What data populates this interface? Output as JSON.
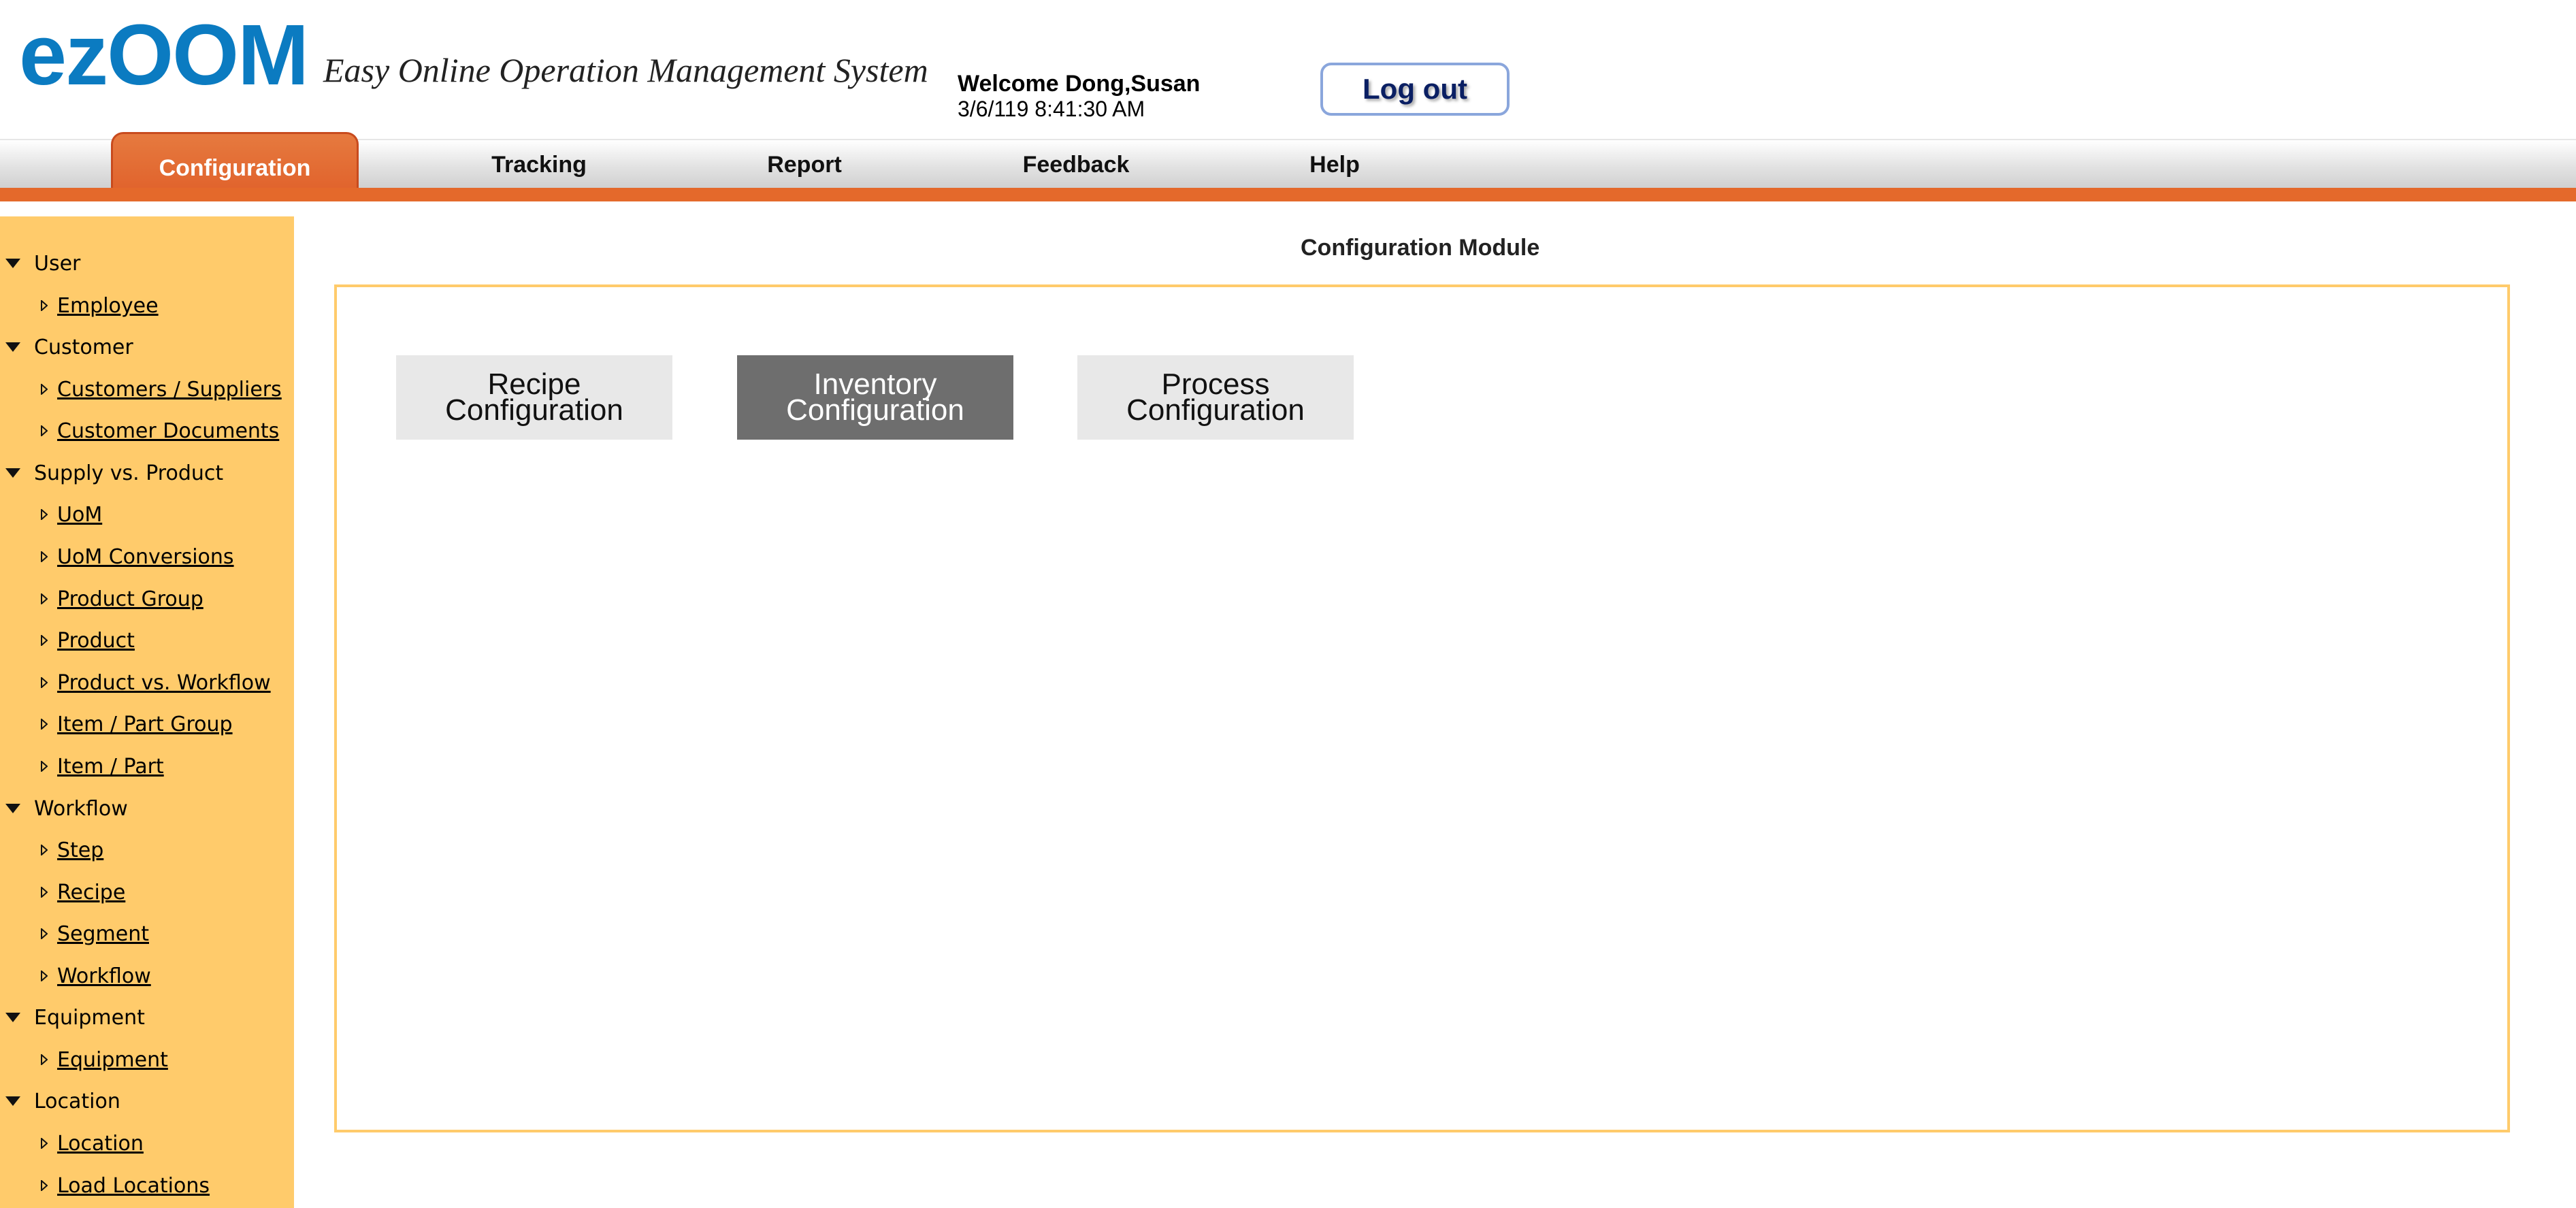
{
  "header": {
    "logo": "ezOOM",
    "tagline": "Easy Online Operation Management System",
    "welcome": "Welcome Dong,Susan",
    "timestamp": "3/6/119 8:41:30 AM",
    "logout_label": "Log out"
  },
  "nav": {
    "tabs": [
      {
        "label": "Configuration",
        "active": true
      },
      {
        "label": "Tracking"
      },
      {
        "label": "Report"
      },
      {
        "label": "Feedback"
      },
      {
        "label": "Help"
      }
    ]
  },
  "sidebar": {
    "groups": [
      {
        "label": "User",
        "items": [
          "Employee"
        ]
      },
      {
        "label": "Customer",
        "items": [
          "Customers / Suppliers",
          "Customer Documents"
        ]
      },
      {
        "label": "Supply vs. Product",
        "items": [
          "UoM",
          "UoM Conversions",
          "Product Group",
          "Product",
          "Product vs. Workflow",
          "Item / Part Group",
          "Item / Part"
        ]
      },
      {
        "label": "Workflow",
        "items": [
          "Step",
          "Recipe",
          "Segment",
          "Workflow"
        ]
      },
      {
        "label": "Equipment",
        "items": [
          "Equipment"
        ]
      },
      {
        "label": "Location",
        "items": [
          "Location",
          "Load Locations"
        ]
      }
    ]
  },
  "main": {
    "title": "Configuration Module",
    "buttons": [
      {
        "line1": "Recipe",
        "line2": "Configuration"
      },
      {
        "line1": "Inventory",
        "line2": "Configuration",
        "selected": true
      },
      {
        "line1": "Process",
        "line2": "Configuration"
      }
    ]
  },
  "colors": {
    "accent_orange": "#e4692b",
    "sidebar_bg": "#ffcb6b",
    "logo_blue": "#0b7bc1",
    "selected_button": "#6e6e6e"
  }
}
